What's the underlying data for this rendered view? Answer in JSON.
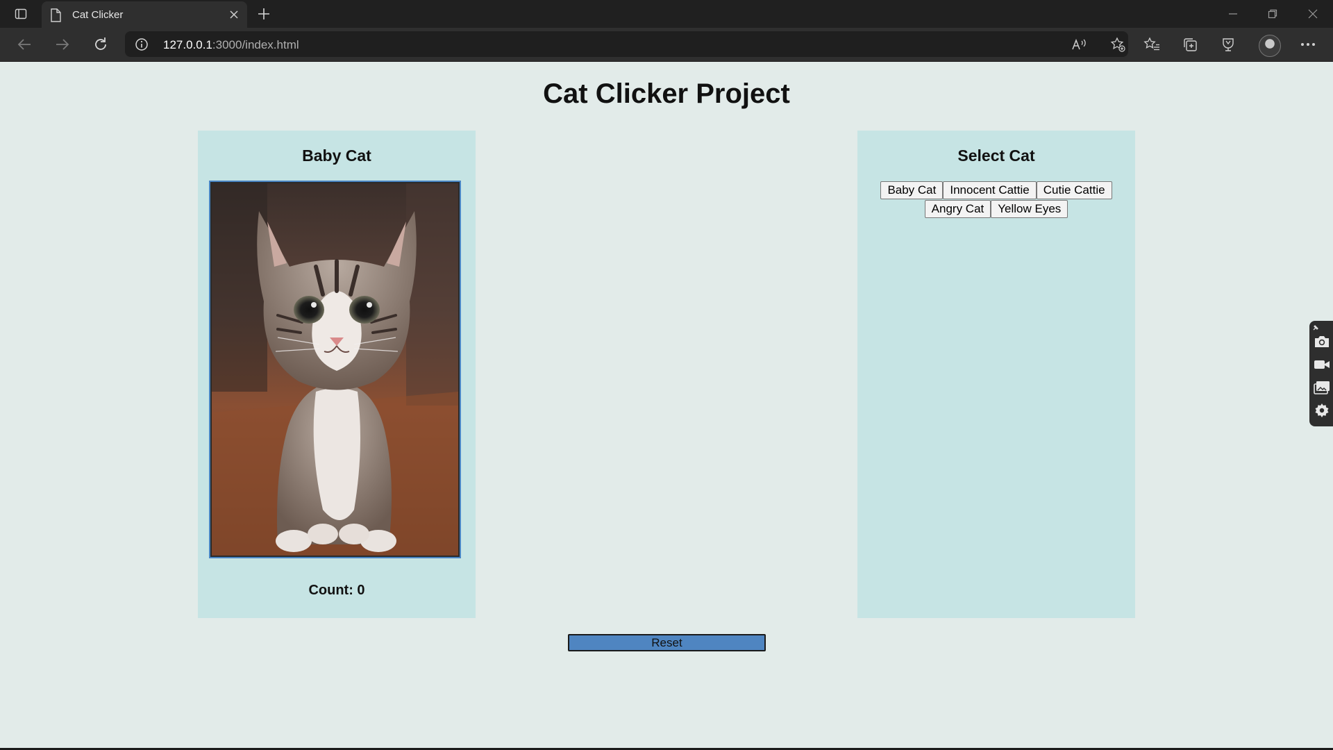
{
  "browser": {
    "tab_title": "Cat Clicker",
    "url_host": "127.0.0.1",
    "url_rest": ":3000/index.html"
  },
  "page": {
    "title": "Cat Clicker Project",
    "reset_label": "Reset"
  },
  "cat_panel": {
    "name": "Baby Cat",
    "count_label": "Count: 0"
  },
  "select_panel": {
    "heading": "Select Cat",
    "buttons": [
      "Baby Cat",
      "Innocent Cattie",
      "Cutie Cattie",
      "Angry Cat",
      "Yellow Eyes"
    ]
  },
  "colors": {
    "page_background": "#e2ebe9",
    "panel_background": "#c6e4e4",
    "reset_button": "#4f85c1",
    "image_border": "#4a86c4"
  }
}
